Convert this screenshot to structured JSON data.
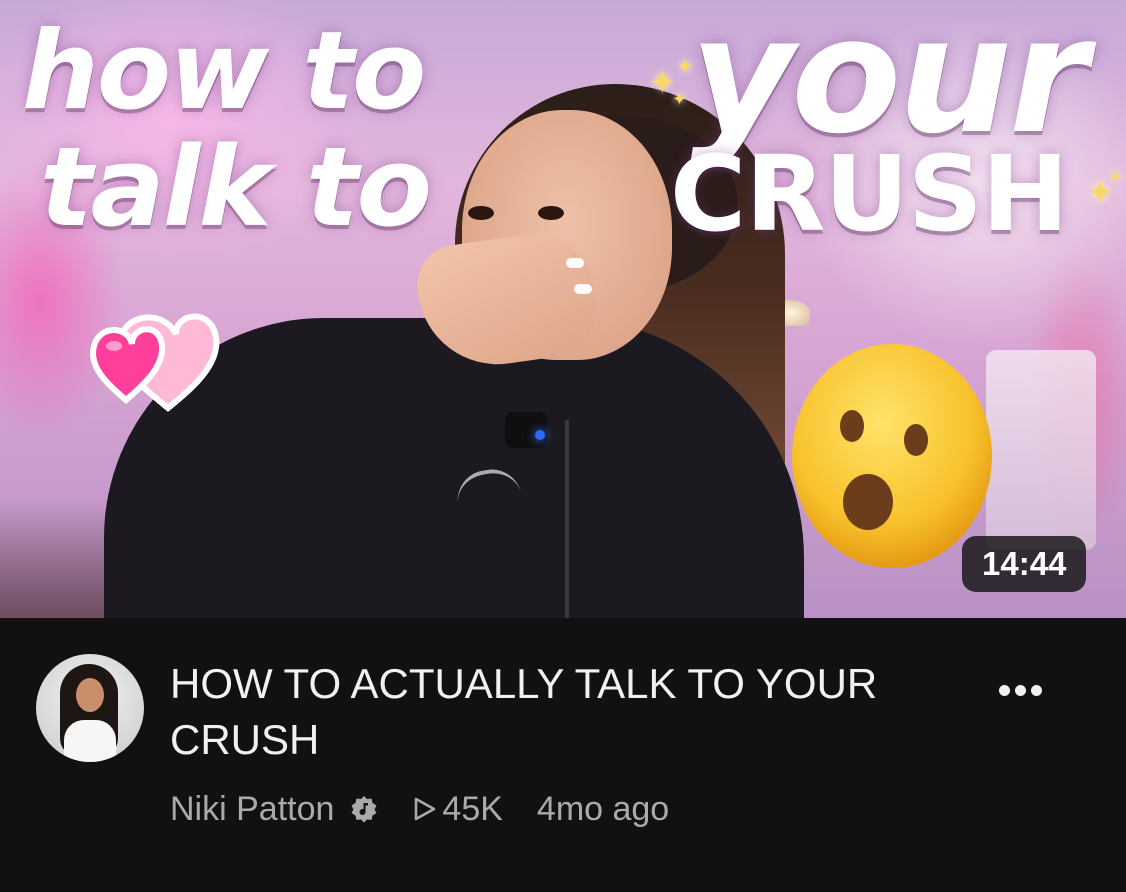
{
  "thumbnail": {
    "overlay_text": [
      "how to",
      "talk to",
      "your",
      "CRUSH"
    ],
    "duration": "14:44"
  },
  "video": {
    "title": "HOW TO ACTUALLY TALK TO YOUR CRUSH",
    "channel": "Niki Patton",
    "views": "45K",
    "age": "4mo ago"
  },
  "icons": {
    "verified": "music-note-badge-icon",
    "views": "play-outline-icon",
    "more": "more-horizontal-icon",
    "thumbnail_emojis": [
      "two-hearts-icon",
      "astonished-face-icon",
      "sparkles-icon"
    ]
  },
  "colors": {
    "background": "#111111",
    "title": "#f1f1f1",
    "meta": "#aaaaaa",
    "duration_badge": "#141414"
  }
}
